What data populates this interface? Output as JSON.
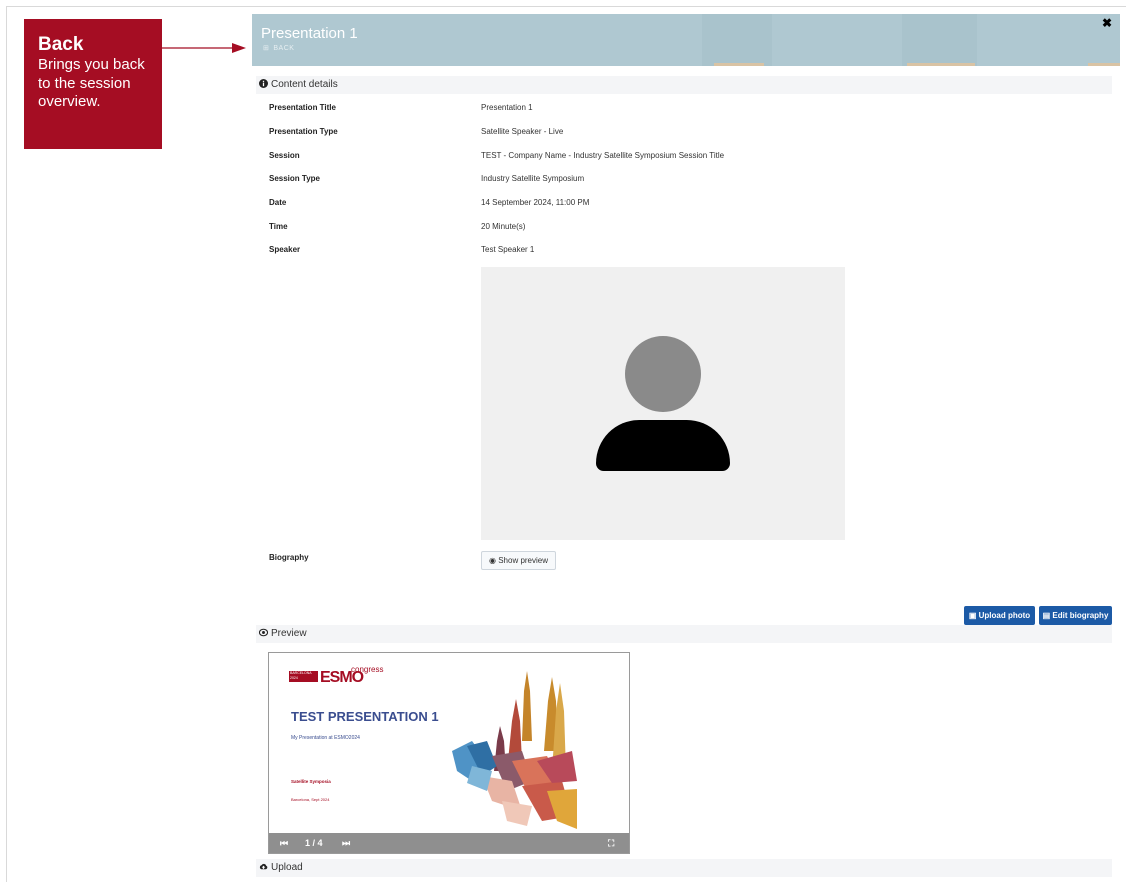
{
  "callout": {
    "title": "Back",
    "description": "Brings you back to the session overview."
  },
  "header": {
    "title": "Presentation 1",
    "back_label": "BACK",
    "close_glyph": "✖"
  },
  "sections": {
    "content_details": "Content details",
    "preview": "Preview",
    "upload": "Upload"
  },
  "details": [
    {
      "label": "Presentation Title",
      "value": "Presentation 1"
    },
    {
      "label": "Presentation Type",
      "value": "Satellite Speaker - Live"
    },
    {
      "label": "Session",
      "value": "TEST - Company Name - Industry Satellite Symposium Session Title"
    },
    {
      "label": "Session Type",
      "value": "Industry Satellite Symposium"
    },
    {
      "label": "Date",
      "value": "14 September 2024, 11:00 PM"
    },
    {
      "label": "Time",
      "value": "20 Minute(s)"
    },
    {
      "label": "Speaker",
      "value": "Test Speaker 1"
    }
  ],
  "biography": {
    "label": "Biography",
    "show_preview": "Show preview"
  },
  "actions": {
    "upload_photo": "Upload photo",
    "edit_biography": "Edit biography"
  },
  "slide": {
    "logo_box": "BARCELONA 2024",
    "logo_main": "ESMO",
    "logo_suffix": "congress",
    "title": "TEST PRESENTATION 1",
    "subtitle": "My Presentation at ESMO2024",
    "symposium": "Satellite Symposia",
    "place_date": "Barcelona, Sept 2024",
    "page_indicator": "1 / 4"
  },
  "colors": {
    "callout": "#a50d23",
    "header": "#afc8d1",
    "primary_button": "#1c5aa6",
    "section_bg": "#f4f5f7"
  },
  "icons": {
    "close": "close-icon",
    "back": "back-icon",
    "info": "info-icon",
    "eye": "eye-icon",
    "camera": "camera-icon",
    "document": "document-icon",
    "cloud_upload": "cloud-upload-icon",
    "first": "first-page-icon",
    "next": "next-page-icon",
    "fullscreen": "fullscreen-icon"
  }
}
